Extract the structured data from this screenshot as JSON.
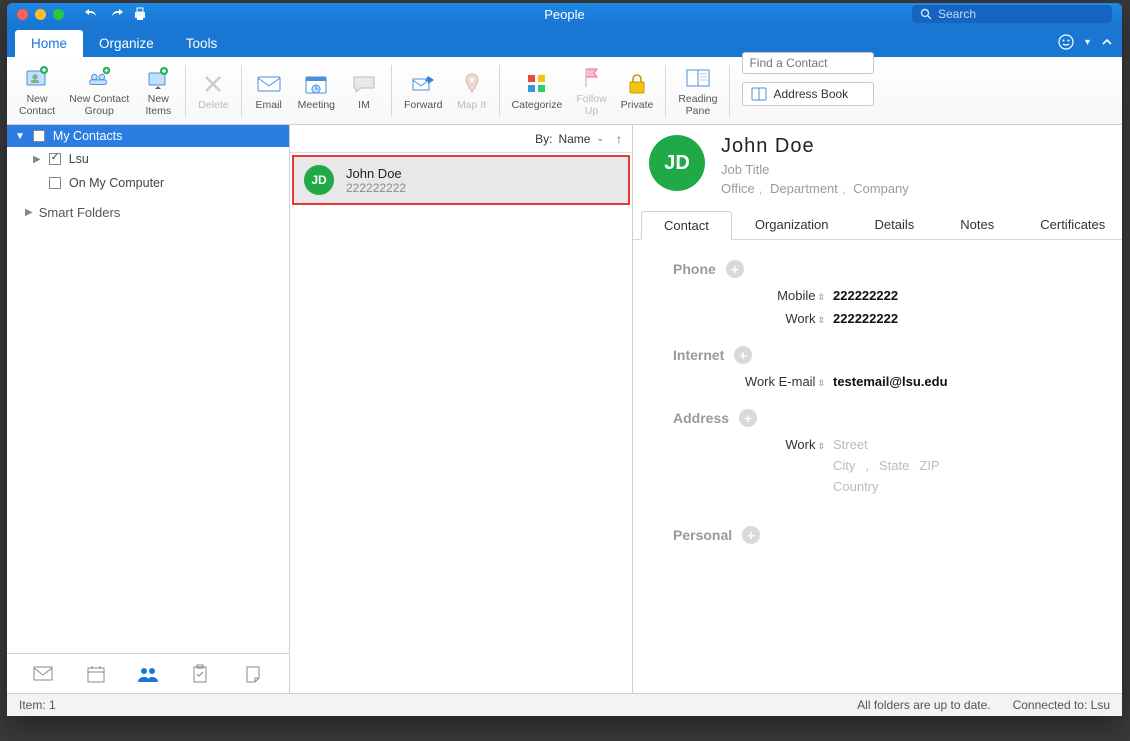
{
  "window": {
    "title": "People",
    "search_placeholder": "Search"
  },
  "tabs": {
    "home": "Home",
    "organize": "Organize",
    "tools": "Tools"
  },
  "ribbon": {
    "new_contact": "New\nContact",
    "new_contact_group": "New Contact\nGroup",
    "new_items": "New\nItems",
    "delete": "Delete",
    "email": "Email",
    "meeting": "Meeting",
    "im": "IM",
    "forward": "Forward",
    "map_it": "Map It",
    "categorize": "Categorize",
    "follow_up": "Follow\nUp",
    "private": "Private",
    "reading_pane": "Reading\nPane",
    "find_contact_placeholder": "Find a Contact",
    "address_book": "Address Book"
  },
  "sidebar": {
    "my_contacts": "My Contacts",
    "lsu": "Lsu",
    "on_my_computer": "On My Computer",
    "smart_folders": "Smart Folders"
  },
  "list": {
    "sort_prefix": "By:",
    "sort_field": "Name",
    "items": [
      {
        "initials": "JD",
        "name": "John Doe",
        "phone": "222222222"
      }
    ]
  },
  "detail": {
    "initials": "JD",
    "name": "John  Doe",
    "job_title": "Job Title",
    "office": "Office",
    "department": "Department",
    "company": "Company",
    "tabs": {
      "contact": "Contact",
      "organization": "Organization",
      "details": "Details",
      "notes": "Notes",
      "certificates": "Certificates"
    },
    "phone": {
      "label": "Phone",
      "mobile_label": "Mobile",
      "work_label": "Work",
      "mobile": "222222222",
      "work": "222222222"
    },
    "internet": {
      "label": "Internet",
      "work_email_label": "Work E-mail",
      "work_email": "testemail@lsu.edu"
    },
    "address": {
      "label": "Address",
      "work_label": "Work",
      "street": "Street",
      "city": "City",
      "state": "State",
      "zip": "ZIP",
      "country": "Country"
    },
    "personal": {
      "label": "Personal"
    }
  },
  "status": {
    "item_count": "Item: 1",
    "sync": "All folders are up to date.",
    "connection": "Connected to: Lsu"
  }
}
